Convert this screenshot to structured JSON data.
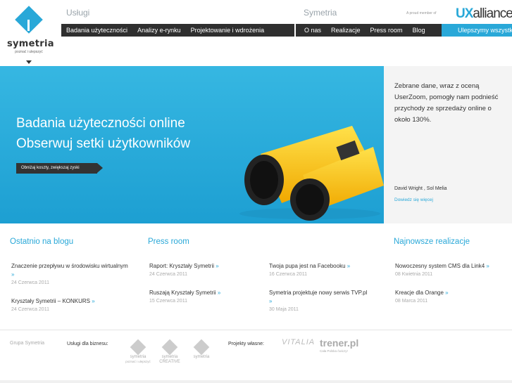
{
  "brand": {
    "name": "symetria",
    "tagline": "poznać i ulepszyć"
  },
  "header": {
    "sections": [
      "Usługi",
      "Symetria"
    ],
    "nav_left": [
      "Badania użyteczności",
      "Analizy e-rynku",
      "Projektowanie i wdrożenia"
    ],
    "nav_right": [
      "O nas",
      "Realizacje",
      "Press room",
      "Blog"
    ],
    "nav_blue": "Ulepszymy wszystko",
    "proud_member": "A proud member of",
    "partner": {
      "ux": "UX",
      "rest": "alliance"
    }
  },
  "hero": {
    "line1": "Badania użyteczności online",
    "line2": "Obserwuj setki użytkowników",
    "button": "Obniżaj koszty, zwiększaj zyski",
    "quote": "Zebrane dane, wraz z oceną UserZoom, pomogły nam podnieść przychody ze sprzedaży online o około 130%.",
    "author": "David Wright , Sol Melia",
    "more": "Dowiedz się więcej"
  },
  "columns": {
    "blog": {
      "title": "Ostatnio na blogu",
      "items": [
        {
          "text": "Znaczenie przepływu w środowisku wirtualnym",
          "date": "24 Czerwca 2011"
        },
        {
          "text": "Kryształy Symetrii – KONKURS",
          "date": "24 Czerwca 2011"
        }
      ]
    },
    "press": {
      "title": "Press room",
      "items": [
        {
          "text": "Raport: Kryształy Symetrii",
          "date": "24 Czerwca 2011"
        },
        {
          "text": "Ruszają Kryształy Symetrii",
          "date": "15 Czerwca 2011"
        },
        {
          "text": "Twoja pupa jest na Facebooku",
          "date": "16 Czerwca 2011"
        },
        {
          "text": "Symetria projektuje nowy serwis TVP.pl",
          "date": "30 Maja 2011"
        }
      ]
    },
    "realizations": {
      "title": "Najnowsze realizacje",
      "items": [
        {
          "text": "Nowoczesny system CMS dla Link4",
          "date": "08 Kwietnia 2011"
        },
        {
          "text": "Kreacje dla Orange",
          "date": "08 Marca 2011"
        }
      ]
    }
  },
  "footer": {
    "group": "Grupa Symetria",
    "business_label": "Usługi dla biznesu:",
    "own_label": "Projekty własne:",
    "business_logos": [
      {
        "name": "symetria",
        "sub": "poznać i ulepszyć"
      },
      {
        "name": "symetria CREATIVE",
        "sub": ""
      },
      {
        "name": "symetria",
        "sub": ""
      }
    ],
    "vitalia": "VITALIA",
    "trener": "trener.pl",
    "trener_sub": "Cała Polska ćwiczy!"
  },
  "colors": {
    "accent": "#29a8d8",
    "nav": "#2f2f2f",
    "hero": "#2aace0"
  },
  "icons": {
    "arrow": "»"
  }
}
